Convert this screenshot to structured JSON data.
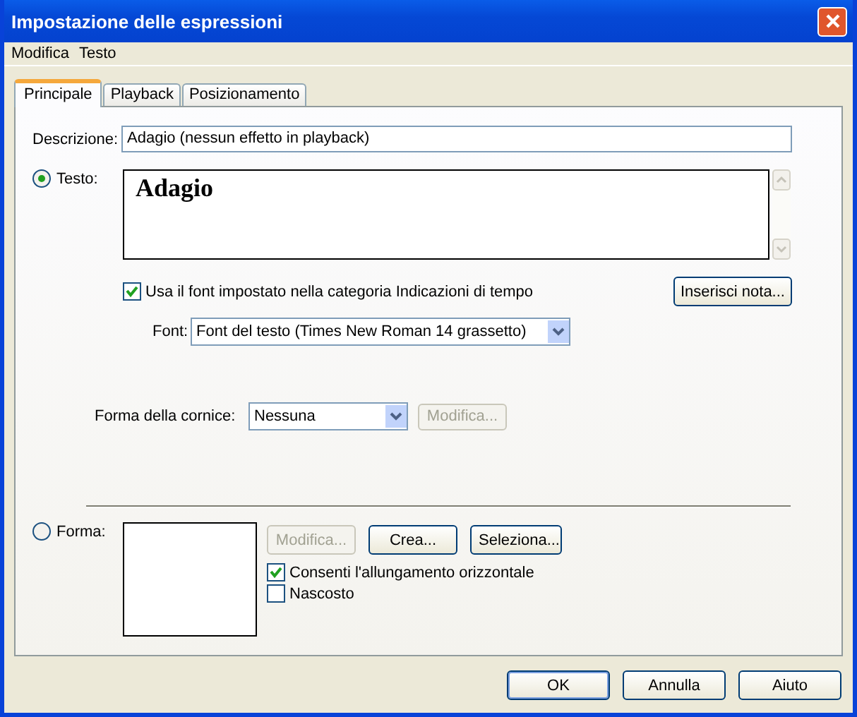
{
  "window": {
    "title": "Impostazione delle espressioni"
  },
  "menu": [
    "Modifica",
    "Testo"
  ],
  "tabs": [
    {
      "label": "Principale",
      "selected": true
    },
    {
      "label": "Playback",
      "selected": false
    },
    {
      "label": "Posizionamento",
      "selected": false
    }
  ],
  "description": {
    "label": "Descrizione:",
    "value": "Adagio (nessun effetto in playback)"
  },
  "text_option": {
    "label": "Testo:",
    "selected": true,
    "value": "Adagio"
  },
  "use_font": {
    "label": "Usa il font impostato nella categoria Indicazioni di tempo",
    "checked": true
  },
  "insert_note_button": "Inserisci nota...",
  "font": {
    "label": "Font:",
    "value": "Font del testo (Times New Roman 14 grassetto)"
  },
  "frame_shape": {
    "label": "Forma della cornice:",
    "value": "Nessuna",
    "edit_button": {
      "label": "Modifica...",
      "disabled": true
    }
  },
  "shape_option": {
    "label": "Forma:",
    "selected": false
  },
  "shape_buttons": [
    {
      "label": "Modifica...",
      "disabled": true
    },
    {
      "label": "Crea...",
      "disabled": false
    },
    {
      "label": "Seleziona...",
      "disabled": false
    }
  ],
  "shape_checks": [
    {
      "label": "Consenti l'allungamento orizzontale",
      "checked": true
    },
    {
      "label": "Nascosto",
      "checked": false
    }
  ],
  "footer_buttons": [
    {
      "label": "OK",
      "default": true
    },
    {
      "label": "Annulla",
      "default": false
    },
    {
      "label": "Aiuto",
      "default": false
    }
  ]
}
